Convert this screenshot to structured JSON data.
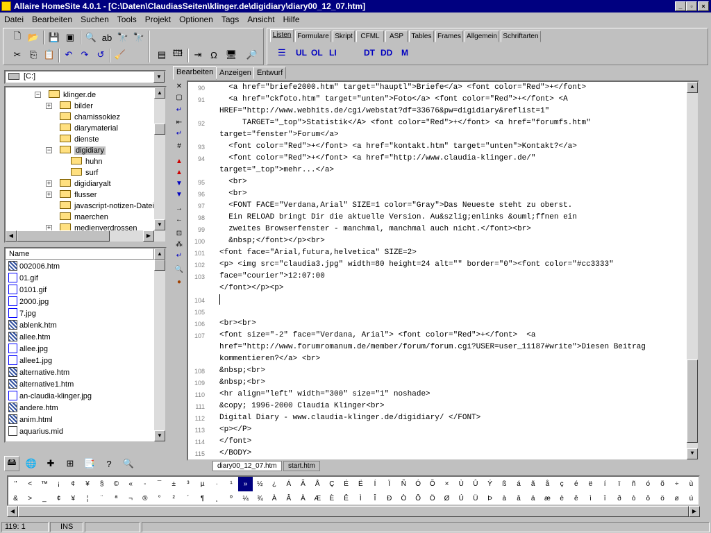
{
  "window": {
    "title": "Allaire HomeSite 4.0.1 - [C:\\Daten\\ClaudiasSeiten\\klinger.de\\digidiary\\diary00_12_07.htm]"
  },
  "menu": [
    "Datei",
    "Bearbeiten",
    "Suchen",
    "Tools",
    "Projekt",
    "Optionen",
    "Tags",
    "Ansicht",
    "Hilfe"
  ],
  "quickbar_tabs": [
    "Listen",
    "Formulare",
    "Skript",
    "CFML",
    "ASP",
    "Tables",
    "Frames",
    "Allgemein",
    "Schriftarten"
  ],
  "quickbar_buttons": [
    "UL",
    "OL",
    "LI",
    "DT",
    "DD",
    "M"
  ],
  "drive": {
    "label": "[C:]"
  },
  "tree": [
    {
      "label": "klinger.de",
      "level": 2,
      "expand": "minus"
    },
    {
      "label": "bilder",
      "level": 3,
      "expand": "plus"
    },
    {
      "label": "chamissokiez",
      "level": 3,
      "expand": ""
    },
    {
      "label": "diarymaterial",
      "level": 3,
      "expand": ""
    },
    {
      "label": "dienste",
      "level": 3,
      "expand": ""
    },
    {
      "label": "digidiary",
      "level": 3,
      "expand": "minus"
    },
    {
      "label": "huhn",
      "level": 4,
      "expand": ""
    },
    {
      "label": "surf",
      "level": 4,
      "expand": ""
    },
    {
      "label": "digidiaryalt",
      "level": 3,
      "expand": "plus"
    },
    {
      "label": "flusser",
      "level": 3,
      "expand": "plus"
    },
    {
      "label": "javascript-notizen-Dateien",
      "level": 3,
      "expand": ""
    },
    {
      "label": "maerchen",
      "level": 3,
      "expand": ""
    },
    {
      "label": "medienverdrossen",
      "level": 3,
      "expand": "plus"
    }
  ],
  "filelist": {
    "header": "Name",
    "files": [
      {
        "name": "002006.htm",
        "type": "html"
      },
      {
        "name": "01.gif",
        "type": "img"
      },
      {
        "name": "0101.gif",
        "type": "img"
      },
      {
        "name": "2000.jpg",
        "type": "img"
      },
      {
        "name": "7.jpg",
        "type": "img"
      },
      {
        "name": "ablenk.htm",
        "type": "html"
      },
      {
        "name": "allee.htm",
        "type": "html"
      },
      {
        "name": "allee.jpg",
        "type": "img"
      },
      {
        "name": "allee1.jpg",
        "type": "img"
      },
      {
        "name": "alternative.htm",
        "type": "html"
      },
      {
        "name": "alternative1.htm",
        "type": "html"
      },
      {
        "name": "an-claudia-klinger.jpg",
        "type": "img"
      },
      {
        "name": "andere.htm",
        "type": "html"
      },
      {
        "name": "anim.html",
        "type": "html"
      },
      {
        "name": "aquarius.mid",
        "type": "mid"
      }
    ]
  },
  "editor_tabs": [
    "Bearbeiten",
    "Anzeigen",
    "Entwurf"
  ],
  "code_lines": [
    {
      "n": "90",
      "t": "  <a href=\"briefe2000.htm\" target=\"hauptl\">Briefe</a> <font color=\"Red\">+</font>"
    },
    {
      "n": "91",
      "t": "  <a href=\"ckfoto.htm\" target=\"unten\">Foto</a> <font color=\"Red\">+</font> <A"
    },
    {
      "n": "",
      "t": "HREF=\"http://www.webhits.de/cgi/webstat?df=33676&pw=digidiary&reflist=1\""
    },
    {
      "n": "92",
      "t": "     TARGET=\"_top\">Statistik</A> <font color=\"Red\">+</font> <a href=\"forumfs.htm\""
    },
    {
      "n": "",
      "t": "target=\"fenster\">Forum</a>"
    },
    {
      "n": "93",
      "t": "  <font color=\"Red\">+</font> <a href=\"kontakt.htm\" target=\"unten\">Kontakt?</a>"
    },
    {
      "n": "94",
      "t": "  <font color=\"Red\">+</font> <a href=\"http://www.claudia-klinger.de/\""
    },
    {
      "n": "",
      "t": "target=\"_top\">mehr...</a>"
    },
    {
      "n": "95",
      "t": "  <br>"
    },
    {
      "n": "96",
      "t": "  <br>"
    },
    {
      "n": "97",
      "t": "  <FONT FACE=\"Verdana,Arial\" SIZE=1 color=\"Gray\">Das Neueste steht zu oberst."
    },
    {
      "n": "98",
      "t": "  Ein RELOAD bringt Dir die aktuelle Version. Au&szlig;enlinks &ouml;ffnen ein"
    },
    {
      "n": "99",
      "t": "  zweites Browserfenster - manchmal, manchmal auch nicht.</font><br>"
    },
    {
      "n": "100",
      "t": "  &nbsp;</font></p><br>"
    },
    {
      "n": "101",
      "t": "<font face=\"Arial,futura,helvetica\" SIZE=2>"
    },
    {
      "n": "102",
      "t": "<p> <img src=\"claudia3.jpg\" width=80 height=24 alt=\"\" border=\"0\"><font color=\"#cc3333\""
    },
    {
      "n": "103",
      "t": "face=\"courier\">12:07:00"
    },
    {
      "n": "",
      "t": "</font></p><p>"
    },
    {
      "n": "104",
      "t": ""
    },
    {
      "n": "105",
      "t": ""
    },
    {
      "n": "106",
      "t": "<br><br>"
    },
    {
      "n": "107",
      "t": "<font size=\"-2\" face=\"Verdana, Arial\"> <font color=\"Red\">+</font>  <a"
    },
    {
      "n": "",
      "t": "href=\"http://www.forumromanum.de/member/forum/forum.cgi?USER=user_11187#write\">Diesen Beitrag"
    },
    {
      "n": "",
      "t": "kommentieren?</a> <br>"
    },
    {
      "n": "108",
      "t": "&nbsp;<br>"
    },
    {
      "n": "109",
      "t": "&nbsp;<br>"
    },
    {
      "n": "110",
      "t": "<hr align=\"left\" width=\"300\" size=\"1\" noshade>"
    },
    {
      "n": "111",
      "t": "&copy; 1996-2000 Claudia Klinger<br>"
    },
    {
      "n": "112",
      "t": "Digital Diary - www.claudia-klinger.de/digidiary/ </FONT>"
    },
    {
      "n": "113",
      "t": "<p></P>"
    },
    {
      "n": "114",
      "t": "</font>"
    },
    {
      "n": "115",
      "t": "</BODY>"
    }
  ],
  "doc_tabs": [
    "diary00_12_07.htm",
    "start.htm"
  ],
  "charmap": {
    "row1": [
      "\"",
      "<",
      "™",
      "¡",
      "¢",
      "¥",
      "§",
      "©",
      "«",
      "-",
      "¯",
      "±",
      "³",
      "µ",
      "·",
      "¹",
      "»",
      "½",
      "¿",
      "Á",
      "Ã",
      "Å",
      "Ç",
      "É",
      "Ë",
      "Í",
      "Ï",
      "Ñ",
      "Ó",
      "Õ",
      "×",
      "Ù",
      "Û",
      "Ý",
      "ß",
      "á",
      "ã",
      "å",
      "ç",
      "é",
      "ë",
      "í",
      "ï",
      "ñ",
      "ó",
      "õ",
      "÷",
      "ù"
    ],
    "row2": [
      "&",
      ">",
      "_",
      "¢",
      "¥",
      "¦",
      "¨",
      "ª",
      "¬",
      "®",
      "°",
      "²",
      "´",
      "¶",
      "¸",
      "º",
      "¼",
      "¾",
      "À",
      "Â",
      "Ä",
      "Æ",
      "È",
      "Ê",
      "Ì",
      "Î",
      "Ð",
      "Ò",
      "Ô",
      "Ö",
      "Ø",
      "Ú",
      "Ü",
      "Þ",
      "à",
      "â",
      "ä",
      "æ",
      "è",
      "ê",
      "ì",
      "î",
      "ð",
      "ò",
      "ô",
      "ö",
      "ø",
      "ú"
    ],
    "selected": "»"
  },
  "status": {
    "position": "119: 1",
    "mode": "INS"
  }
}
